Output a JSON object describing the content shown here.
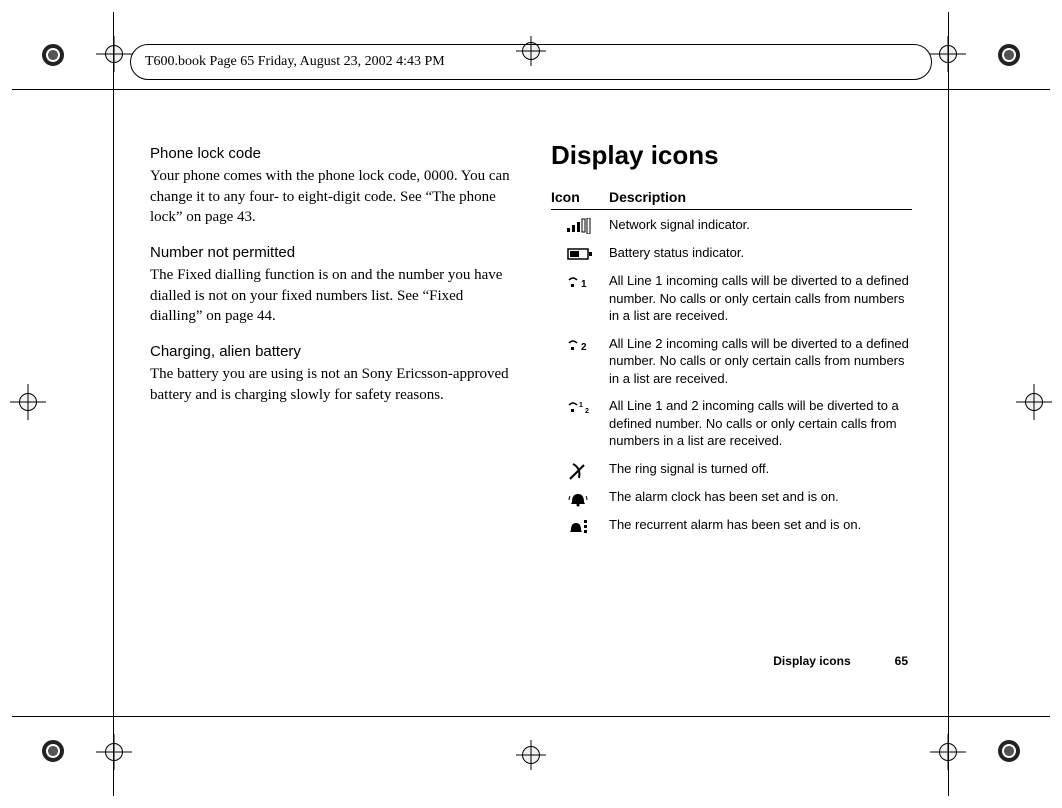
{
  "header": {
    "text": "T600.book  Page 65  Friday, August 23, 2002  4:43 PM"
  },
  "left": {
    "sections": [
      {
        "head": "Phone lock code",
        "body": "Your phone comes with the phone lock code, 0000. You can change it to any four- to eight-digit code. See “The phone lock” on page 43."
      },
      {
        "head": "Number not permitted",
        "body": "The Fixed dialling function is on and the number you have dialled is not on your fixed numbers list. See “Fixed dialling” on page 44."
      },
      {
        "head": "Charging, alien battery",
        "body": "The battery you are using is not an Sony Ericsson-approved battery and is charging slowly for safety reasons."
      }
    ]
  },
  "right": {
    "title": "Display icons",
    "table_head": {
      "icon": "Icon",
      "desc": "Description"
    },
    "rows": [
      {
        "icon_name": "signal-bars-icon",
        "desc": "Network signal indicator."
      },
      {
        "icon_name": "battery-icon",
        "desc": "Battery status indicator."
      },
      {
        "icon_name": "divert-line1-icon",
        "desc": "All Line 1 incoming calls will be diverted to a defined number. No calls or only certain calls from numbers in a list are received."
      },
      {
        "icon_name": "divert-line2-icon",
        "desc": "All Line 2 incoming calls will be diverted to a defined number. No calls or only certain calls from numbers in a list are received."
      },
      {
        "icon_name": "divert-line12-icon",
        "desc": "All Line 1 and 2 incoming calls will be diverted to a defined number. No calls or only certain calls from numbers in a list are received."
      },
      {
        "icon_name": "ring-off-icon",
        "desc": "The ring signal is turned off."
      },
      {
        "icon_name": "alarm-on-icon",
        "desc": "The alarm clock has been set and is on."
      },
      {
        "icon_name": "recurrent-alarm-icon",
        "desc": "The recurrent alarm has been set and is on."
      }
    ]
  },
  "footer": {
    "section": "Display icons",
    "page": "65"
  }
}
